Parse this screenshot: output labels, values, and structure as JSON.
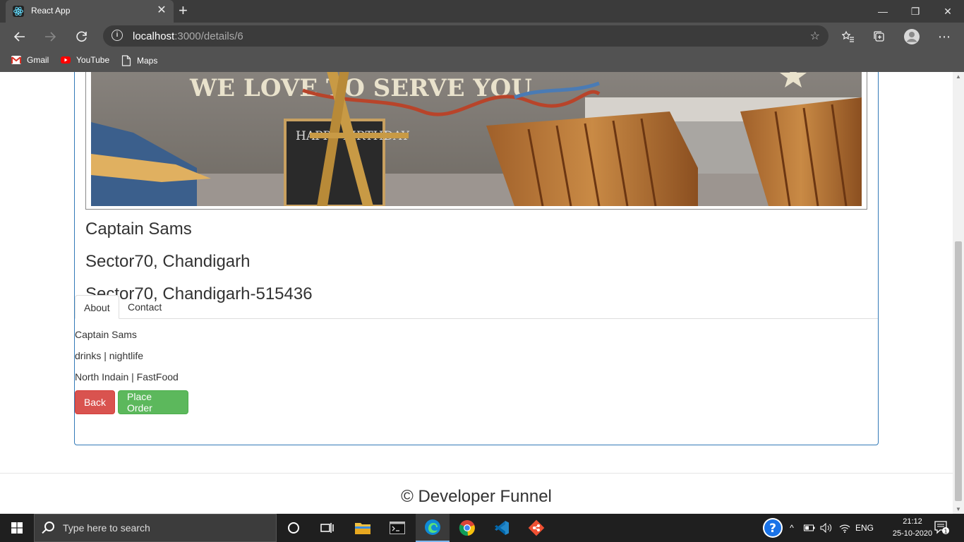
{
  "browser": {
    "tab_title": "React App",
    "new_tab_symbol": "+",
    "url_host": "localhost",
    "url_rest": ":3000/details/6",
    "bookmarks": [
      {
        "label": "Gmail"
      },
      {
        "label": "YouTube"
      },
      {
        "label": "Maps"
      }
    ]
  },
  "restaurant": {
    "name": "Captain Sams",
    "locality": "Sector70, Chandigarh",
    "address": "Sector70, Chandigarh-515436",
    "hero_sign_text": "WE LOVE TO SERVE YOU",
    "board_text": "HAPPY BIRTHDAY"
  },
  "tabs": [
    {
      "label": "About",
      "active": true
    },
    {
      "label": "Contact",
      "active": false
    }
  ],
  "about": {
    "name": "Captain Sams",
    "types": "drinks | nightlife",
    "cuisines": "North Indain | FastFood"
  },
  "buttons": {
    "back": "Back",
    "place_order": "Place Order"
  },
  "footer": {
    "text": "© Developer Funnel"
  },
  "taskbar": {
    "search_placeholder": "Type here to search",
    "language": "ENG",
    "time": "21:12",
    "date": "25-10-2020",
    "notification_count": "1"
  },
  "colors": {
    "panel_border": "#337ab7",
    "btn_danger": "#d9534f",
    "btn_success": "#5cb85c"
  }
}
